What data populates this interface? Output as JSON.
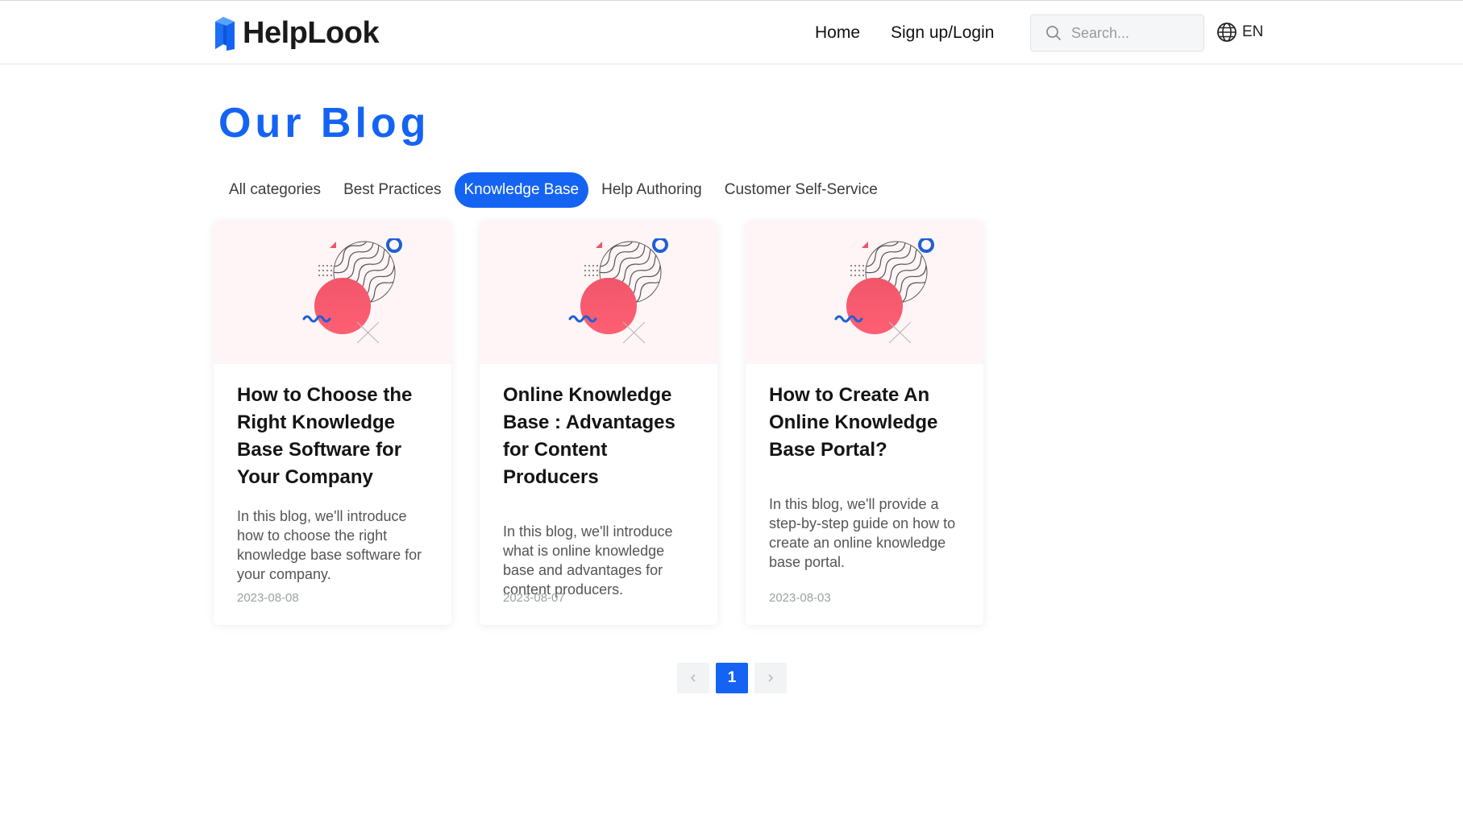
{
  "brand": {
    "name": "HelpLook",
    "color": "#1463f3"
  },
  "nav": {
    "home": "Home",
    "login": "Sign up/Login"
  },
  "search": {
    "placeholder": "Search...",
    "icon": "search-icon"
  },
  "language": {
    "label": "EN",
    "icon": "globe-icon"
  },
  "page": {
    "title": "Our Blog"
  },
  "categories": [
    {
      "label": "All categories",
      "active": false
    },
    {
      "label": "Best Practices",
      "active": false
    },
    {
      "label": "Knowledge Base",
      "active": true
    },
    {
      "label": "Help Authoring",
      "active": false
    },
    {
      "label": "Customer Self-Service",
      "active": false
    }
  ],
  "posts": [
    {
      "title": "How to Choose the Right Knowledge Base Software for Your Company",
      "description": "In this blog, we'll introduce how to choose the right knowledge base software for your company.",
      "date": "2023-08-08"
    },
    {
      "title": "Online Knowledge Base : Advantages for Content Producers",
      "description": "In this blog, we'll introduce what is online knowledge base and advantages for content producers.",
      "date": "2023-08-07"
    },
    {
      "title": "How to Create An Online Knowledge Base Portal?",
      "description": "In this blog, we'll provide a step-by-step guide on how to create an online knowledge base portal.",
      "date": "2023-08-03"
    }
  ],
  "pagination": {
    "current": "1",
    "prev_icon": "chevron-left-icon",
    "next_icon": "chevron-right-icon"
  }
}
